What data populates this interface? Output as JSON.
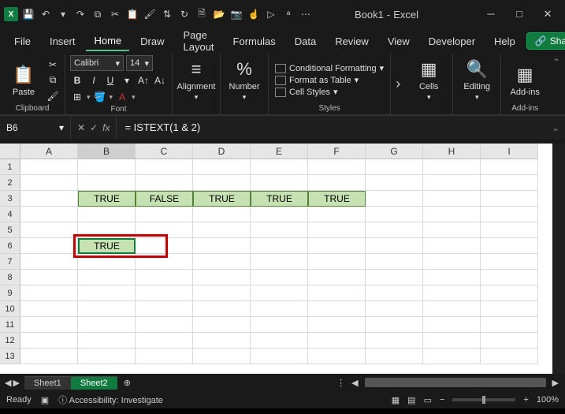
{
  "title": {
    "doc": "Book1",
    "app": "Excel"
  },
  "menu": {
    "tabs": [
      "File",
      "Insert",
      "Home",
      "Draw",
      "Page Layout",
      "Formulas",
      "Data",
      "Review",
      "View",
      "Developer",
      "Help"
    ],
    "active": "Home",
    "share": "Share"
  },
  "ribbon": {
    "clipboard": {
      "paste": "Paste",
      "label": "Clipboard"
    },
    "font": {
      "name": "Calibri",
      "size": "14",
      "bold": "B",
      "italic": "I",
      "underline": "U",
      "label": "Font"
    },
    "alignment": {
      "title": "Alignment"
    },
    "number": {
      "title": "Number",
      "symbol": "%"
    },
    "styles": {
      "conditional": "Conditional Formatting",
      "table": "Format as Table",
      "cell": "Cell Styles",
      "label": "Styles"
    },
    "cells": {
      "title": "Cells"
    },
    "editing": {
      "title": "Editing"
    },
    "addins": {
      "title": "Add-ins",
      "label": "Add-ins"
    }
  },
  "formula_bar": {
    "cell_ref": "B6",
    "formula": "= ISTEXT(1 & 2)"
  },
  "grid": {
    "columns": [
      "A",
      "B",
      "C",
      "D",
      "E",
      "F",
      "G",
      "H",
      "I"
    ],
    "row_numbers": [
      "1",
      "2",
      "3",
      "4",
      "5",
      "6",
      "7",
      "8",
      "9",
      "10",
      "11",
      "12",
      "13"
    ],
    "row3": [
      "",
      "TRUE",
      "FALSE",
      "TRUE",
      "TRUE",
      "TRUE",
      "",
      "",
      ""
    ],
    "b6": "TRUE",
    "selected_col": "B"
  },
  "sheets": {
    "tabs": [
      "Sheet1",
      "Sheet2"
    ],
    "active": "Sheet2"
  },
  "status": {
    "ready": "Ready",
    "access": "Accessibility: Investigate",
    "zoom": "100%"
  }
}
